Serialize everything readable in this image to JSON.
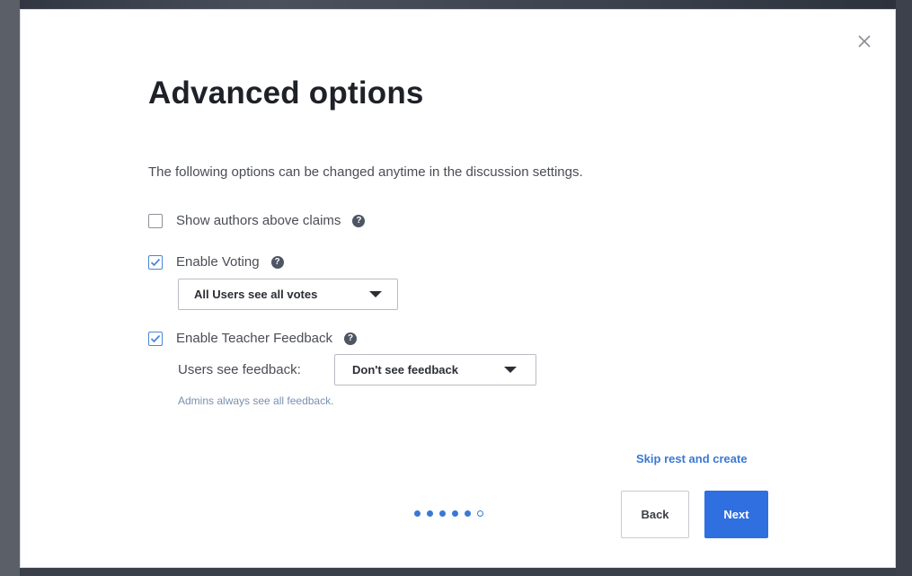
{
  "dialog": {
    "title": "Advanced options",
    "intro": "The following options can be changed anytime in the discussion settings.",
    "close_icon": "close-icon"
  },
  "options": {
    "show_authors": {
      "label": "Show authors above claims",
      "checked": false
    },
    "enable_voting": {
      "label": "Enable Voting",
      "checked": true,
      "select_value": "All Users see all votes"
    },
    "enable_feedback": {
      "label": "Enable Teacher Feedback",
      "checked": true,
      "visibility_label": "Users see feedback:",
      "select_value": "Don't see feedback",
      "note": "Admins always see all feedback."
    },
    "help_glyph": "?"
  },
  "footer": {
    "skip_label": "Skip rest and create",
    "back_label": "Back",
    "next_label": "Next",
    "progress": {
      "total_steps": 6,
      "completed_steps": 5
    }
  },
  "colors": {
    "accent": "#2f6fe0",
    "link": "#3a78d4",
    "checkbox_checked": "#4a86d6",
    "note_text": "#7a8fb0"
  }
}
